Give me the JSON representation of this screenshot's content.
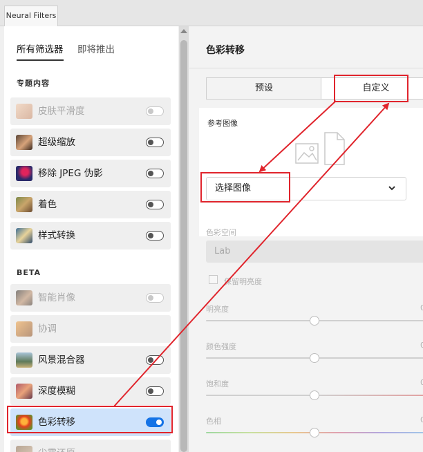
{
  "window": {
    "tab_title": "Neural Filters"
  },
  "left_panel": {
    "tabs": [
      {
        "label": "所有筛选器",
        "active": true
      },
      {
        "label": "即将推出",
        "active": false
      }
    ],
    "sections": [
      {
        "title": "专题内容",
        "items": [
          {
            "label": "皮肤平滑度",
            "enabled": false,
            "on": false
          },
          {
            "label": "超级缩放",
            "enabled": true,
            "on": false
          },
          {
            "label": "移除 JPEG 伪影",
            "enabled": true,
            "on": false
          },
          {
            "label": "着色",
            "enabled": true,
            "on": false
          },
          {
            "label": "样式转换",
            "enabled": true,
            "on": false
          }
        ]
      },
      {
        "title": "BETA",
        "items": [
          {
            "label": "智能肖像",
            "enabled": false,
            "on": false
          },
          {
            "label": "协调",
            "enabled": false,
            "on": false
          },
          {
            "label": "风景混合器",
            "enabled": true,
            "on": false
          },
          {
            "label": "深度模糊",
            "enabled": true,
            "on": false
          },
          {
            "label": "色彩转移",
            "enabled": true,
            "on": true,
            "selected": true
          },
          {
            "label": "尘霞还原",
            "enabled": false,
            "on": false
          }
        ]
      }
    ]
  },
  "right_panel": {
    "title": "色彩转移",
    "mode_tabs": [
      {
        "label": "预设",
        "selected": false
      },
      {
        "label": "自定义",
        "selected": true
      }
    ],
    "reference": {
      "label": "参考图像",
      "select_label": "选择图像"
    },
    "color_space": {
      "label": "色彩空间",
      "value": "Lab"
    },
    "preserve_luminance": {
      "label": "保留明亮度",
      "checked": false
    },
    "sliders": [
      {
        "label": "明亮度",
        "value": 0
      },
      {
        "label": "颜色强度",
        "value": 0
      },
      {
        "label": "饱和度",
        "value": 0
      },
      {
        "label": "色相",
        "value": 0
      }
    ]
  },
  "annotation_color": "#e0242c",
  "accent_color": "#1473e6"
}
